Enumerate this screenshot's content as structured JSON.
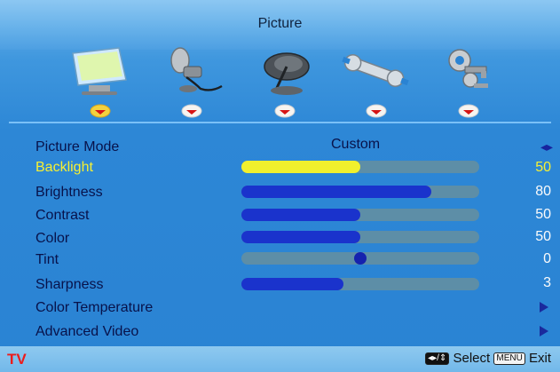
{
  "menu": {
    "title": "Picture",
    "tabs": [
      {
        "icon": "monitor-icon"
      },
      {
        "icon": "microphone-icon"
      },
      {
        "icon": "satellite-dish-icon"
      },
      {
        "icon": "wrench-icon"
      },
      {
        "icon": "keys-icon"
      }
    ]
  },
  "picture_mode": {
    "label": "Picture Mode",
    "value": "Custom"
  },
  "settings": [
    {
      "label": "Backlight",
      "value": "50",
      "level": 50,
      "selected": true
    },
    {
      "label": "Brightness",
      "value": "80",
      "level": 80
    },
    {
      "label": "Contrast",
      "value": "50",
      "level": 50
    },
    {
      "label": "Color",
      "value": "50",
      "level": 50
    },
    {
      "label": "Tint",
      "value": "0",
      "level": 0
    },
    {
      "label": "Sharpness",
      "value": "3",
      "level": 3
    }
  ],
  "submenus": [
    {
      "label": "Color Temperature"
    },
    {
      "label": "Advanced Video"
    }
  ],
  "footer": {
    "source": "TV",
    "select_label": "Select",
    "menu_key": "MENU",
    "exit_label": "Exit"
  }
}
